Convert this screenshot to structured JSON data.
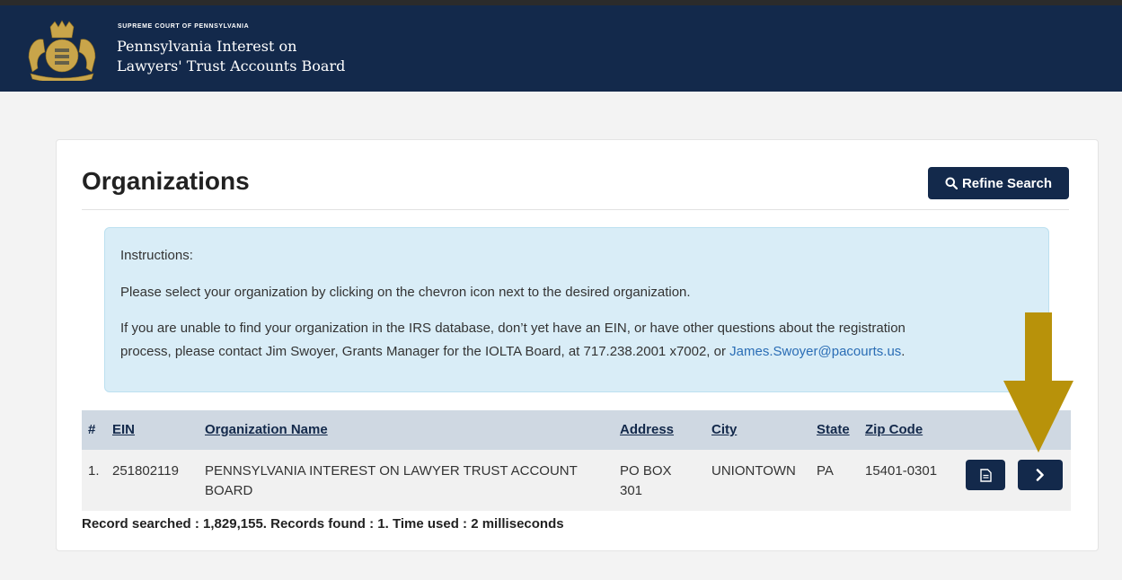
{
  "header": {
    "court_name": "SUPREME COURT OF PENNSYLVANIA",
    "board_line1": "Pennsylvania Interest on",
    "board_line2": "Lawyers' Trust Accounts Board"
  },
  "page": {
    "title": "Organizations",
    "refine_search_label": "Refine Search"
  },
  "instructions": {
    "heading": "Instructions:",
    "line1": "Please select your organization by clicking on the chevron icon next to the desired organization.",
    "line2": "If you are unable to find your organization in the IRS database, don’t yet have an EIN, or have other questions about the registration",
    "line3_prefix": "process, please contact Jim Swoyer, Grants Manager for the IOLTA Board, at 717.238.2001 x7002, or ",
    "email": "James.Swoyer@pacourts.us",
    "line3_suffix": "."
  },
  "table": {
    "headers": [
      "#",
      "EIN",
      "Organization Name",
      "Address",
      "City",
      "State",
      "Zip Code"
    ],
    "rows": [
      {
        "num": "1.",
        "ein": "251802119",
        "name_line1": "PENNSYLVANIA INTEREST ON LAWYER TRUST ACCOUNT",
        "name_line2": "BOARD",
        "address_line1": "PO BOX",
        "address_line2": "301",
        "city": "UNIONTOWN",
        "state": "PA",
        "zip": "15401-0301"
      }
    ]
  },
  "summary": "Record searched : 1,829,155.   Records found : 1.  Time used : 2 milliseconds",
  "icons": {
    "search": "search-icon",
    "document": "document-icon",
    "chevron": "chevron-right-icon",
    "seal": "seal-icon",
    "arrow": "arrow-down-icon"
  },
  "colors": {
    "navy": "#13294b",
    "info_bg": "#d9edf7",
    "table_header_bg": "#cfd8e2",
    "arrow": "#b8920a",
    "link": "#2a6db5"
  }
}
